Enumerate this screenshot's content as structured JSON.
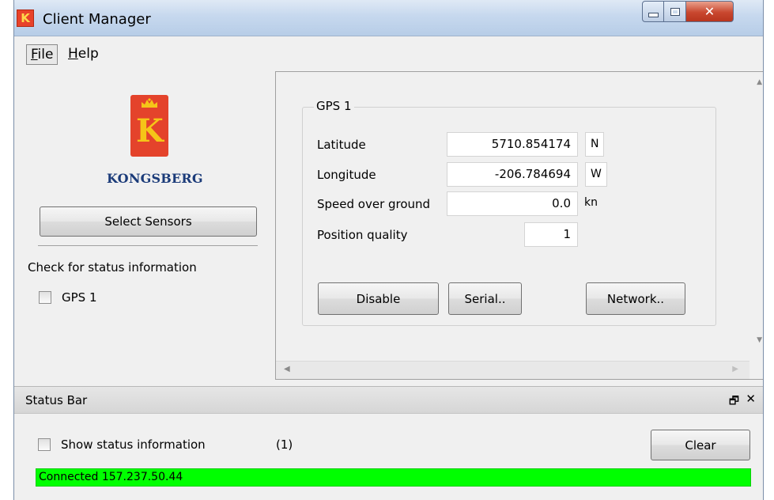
{
  "window": {
    "title": "Client Manager",
    "app_icon_glyph": "K"
  },
  "menu": {
    "file": "File",
    "help": "Help"
  },
  "left": {
    "brand": "KONGSBERG",
    "select_sensors": "Select Sensors",
    "check_label": "Check for status information",
    "sensors": [
      {
        "label": "GPS 1",
        "checked": false
      }
    ]
  },
  "gps": {
    "group_title": "GPS 1",
    "latitude": {
      "label": "Latitude",
      "value": "5710.854174",
      "unit": "N"
    },
    "longitude": {
      "label": "Longitude",
      "value": "-206.784694",
      "unit": "W"
    },
    "speed": {
      "label": "Speed over ground",
      "value": "0.0",
      "unit": "kn"
    },
    "quality": {
      "label": "Position quality",
      "value": "1"
    },
    "buttons": {
      "disable": "Disable",
      "serial": "Serial..",
      "network": "Network.."
    }
  },
  "status_bar": {
    "title": "Status Bar",
    "show_status_label": "Show status information",
    "count": "(1)",
    "clear": "Clear",
    "connected": "Connected 157.237.50.44",
    "connected_color": "#00ff00"
  },
  "icons": {
    "minimize": "minimize-icon",
    "maximize": "maximize-icon",
    "close": "close-icon",
    "float": "float-icon",
    "dock_close": "close-icon"
  }
}
